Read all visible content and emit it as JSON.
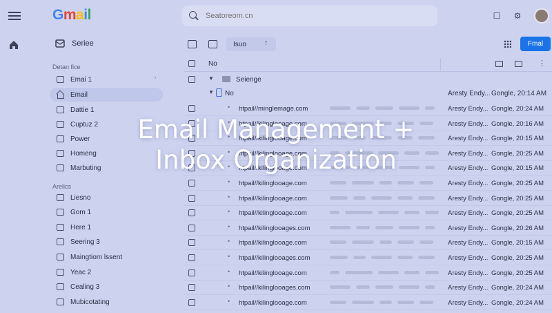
{
  "app": {
    "logo": "Gmail"
  },
  "search": {
    "placeholder": "Seatoreom.cn"
  },
  "sidebar": {
    "compose_label": "Seriee",
    "section1_title": "Detan fice",
    "section2_title": "Arelics",
    "items": [
      {
        "label": "Emai 1",
        "count": "'",
        "icon": "mail-icon"
      },
      {
        "label": "Email",
        "count": "",
        "icon": "home-icon",
        "active": true
      },
      {
        "label": "Dattie 1",
        "count": "",
        "icon": "mail-icon"
      },
      {
        "label": "Cuptuz 2",
        "count": "",
        "icon": "mail-icon"
      },
      {
        "label": "Power",
        "count": "",
        "icon": "doc-icon"
      },
      {
        "label": "Homeng",
        "count": "",
        "icon": "mail-icon"
      },
      {
        "label": "Marbuting",
        "count": "",
        "icon": "doc-icon"
      },
      {
        "label": "Liesno",
        "count": "",
        "icon": "mail-icon"
      },
      {
        "label": "Gom 1",
        "count": "",
        "icon": "mail-icon"
      },
      {
        "label": "Here 1",
        "count": "",
        "icon": "mail-icon"
      },
      {
        "label": "Seering 3",
        "count": "",
        "icon": "mail-icon"
      },
      {
        "label": "Maingtiom lssent",
        "count": "",
        "icon": "doc-icon"
      },
      {
        "label": "Yeac 2",
        "count": "",
        "icon": "doc-icon"
      },
      {
        "label": "Cealing 3",
        "count": "",
        "icon": "doc-icon"
      },
      {
        "label": "Mubicotating",
        "count": "",
        "icon": "mail-icon"
      }
    ]
  },
  "toolbar": {
    "chip_label": "Isuo",
    "primary_button": "Fmal"
  },
  "list": {
    "header_label": "No",
    "group1_label": "Seienge",
    "group2_label": "No",
    "rows": [
      {
        "subject": "htpail//minglemage.com",
        "sender": "Aresty Endy...",
        "time": "Gongle, 20:14 AM"
      },
      {
        "subject": "htpail//minglemage.com",
        "sender": "Aresty Endy...",
        "time": "Gongle, 20:24 AM"
      },
      {
        "subject": "htpail//kilinglooage.com",
        "sender": "Aresty Endy...",
        "time": "Gongle, 20:16 AM"
      },
      {
        "subject": "htpail//kilinglooage.com",
        "sender": "Aresty Endy...",
        "time": "Gongle, 20:15 AM"
      },
      {
        "subject": "htpail//kilinglooage.com",
        "sender": "Aresty Endy...",
        "time": "Gongle, 20:25 AM"
      },
      {
        "subject": "htpail//kilinglooage.com",
        "sender": "Aresty Endy...",
        "time": "Gongle, 20:15 AM"
      },
      {
        "subject": "htpail//kilinglooage.com",
        "sender": "Aresty Endy...",
        "time": "Gongle, 20:25 AM"
      },
      {
        "subject": "htpail//kilinglooage.com",
        "sender": "Aresty Endy...",
        "time": "Gongle, 20:25 AM"
      },
      {
        "subject": "htpail//kilinglooage.com",
        "sender": "Aresty Endy...",
        "time": "Gongle, 20:25 AM"
      },
      {
        "subject": "htpail//kilinglooages.com",
        "sender": "Aresty Endy...",
        "time": "Gongle, 20:26 AM"
      },
      {
        "subject": "htpail//kilinglooage.com",
        "sender": "Aresty Endy...",
        "time": "Gongle, 20:15 AM"
      },
      {
        "subject": "htpail//kilinglooages.com",
        "sender": "Aresty Endy...",
        "time": "Gongle, 20:25 AM"
      },
      {
        "subject": "htpail//kilinglooage.com",
        "sender": "Aresty Endy...",
        "time": "Gongle, 20:25 AM"
      },
      {
        "subject": "htpail//kilinglooages.com",
        "sender": "Aresty Endy...",
        "time": "Gongle, 20:24 AM"
      },
      {
        "subject": "htpail//kilinglooage.com",
        "sender": "Aresty Endy...",
        "time": "Gongle, 20:24 AM"
      }
    ]
  },
  "overlay": {
    "line1": "Email Management +",
    "line2": "Inbox Organization"
  },
  "colors": {
    "accent": "#1a73e8",
    "background": "#cdd3ef"
  }
}
